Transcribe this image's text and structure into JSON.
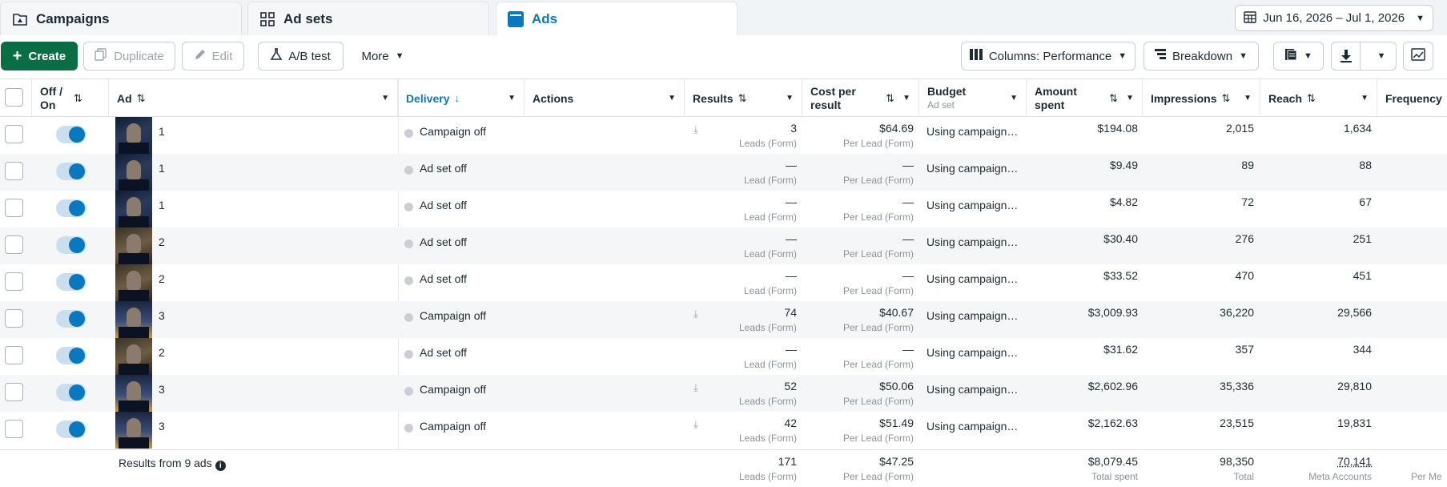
{
  "tabs": {
    "campaigns": "Campaigns",
    "adsets": "Ad sets",
    "ads": "Ads"
  },
  "date_range": "Jun 16, 2026 – Jul 1, 2026",
  "toolbar": {
    "create": "Create",
    "duplicate": "Duplicate",
    "edit": "Edit",
    "ab_test": "A/B test",
    "more": "More",
    "columns": "Columns: Performance",
    "breakdown": "Breakdown"
  },
  "headers": {
    "off_on": "Off / On",
    "ad": "Ad",
    "delivery": "Delivery",
    "actions": "Actions",
    "results": "Results",
    "cost_per_result": "Cost per result",
    "budget": "Budget",
    "budget_sub": "Ad set",
    "amount_spent": "Amount spent",
    "impressions": "Impressions",
    "reach": "Reach",
    "frequency": "Frequency"
  },
  "rows": [
    {
      "ad": "1",
      "delivery": "Campaign off",
      "results": "3",
      "results_sub": "Leads (Form)",
      "cpr": "$64.69",
      "cpr_sub": "Per Lead (Form)",
      "budget": "Using campaign…",
      "spent": "$194.08",
      "impressions": "2,015",
      "reach": "1,634",
      "thumb": "g1",
      "download": true
    },
    {
      "ad": "1",
      "delivery": "Ad set off",
      "results": "—",
      "results_sub": "Lead (Form)",
      "cpr": "—",
      "cpr_sub": "Per Lead (Form)",
      "budget": "Using campaign…",
      "spent": "$9.49",
      "impressions": "89",
      "reach": "88",
      "thumb": "g1",
      "download": false
    },
    {
      "ad": "1",
      "delivery": "Ad set off",
      "results": "—",
      "results_sub": "Lead (Form)",
      "cpr": "—",
      "cpr_sub": "Per Lead (Form)",
      "budget": "Using campaign…",
      "spent": "$4.82",
      "impressions": "72",
      "reach": "67",
      "thumb": "g1",
      "download": false
    },
    {
      "ad": "2",
      "delivery": "Ad set off",
      "results": "—",
      "results_sub": "Lead (Form)",
      "cpr": "—",
      "cpr_sub": "Per Lead (Form)",
      "budget": "Using campaign…",
      "spent": "$30.40",
      "impressions": "276",
      "reach": "251",
      "thumb": "g2",
      "download": false
    },
    {
      "ad": "2",
      "delivery": "Ad set off",
      "results": "—",
      "results_sub": "Lead (Form)",
      "cpr": "—",
      "cpr_sub": "Per Lead (Form)",
      "budget": "Using campaign…",
      "spent": "$33.52",
      "impressions": "470",
      "reach": "451",
      "thumb": "g2",
      "download": false
    },
    {
      "ad": "3",
      "delivery": "Campaign off",
      "results": "74",
      "results_sub": "Leads (Form)",
      "cpr": "$40.67",
      "cpr_sub": "Per Lead (Form)",
      "budget": "Using campaign…",
      "spent": "$3,009.93",
      "impressions": "36,220",
      "reach": "29,566",
      "thumb": "g3",
      "download": true
    },
    {
      "ad": "2",
      "delivery": "Ad set off",
      "results": "—",
      "results_sub": "Lead (Form)",
      "cpr": "—",
      "cpr_sub": "Per Lead (Form)",
      "budget": "Using campaign…",
      "spent": "$31.62",
      "impressions": "357",
      "reach": "344",
      "thumb": "g2",
      "download": false
    },
    {
      "ad": "3",
      "delivery": "Campaign off",
      "results": "52",
      "results_sub": "Leads (Form)",
      "cpr": "$50.06",
      "cpr_sub": "Per Lead (Form)",
      "budget": "Using campaign…",
      "spent": "$2,602.96",
      "impressions": "35,336",
      "reach": "29,810",
      "thumb": "g3",
      "download": true
    },
    {
      "ad": "3",
      "delivery": "Campaign off",
      "results": "42",
      "results_sub": "Leads (Form)",
      "cpr": "$51.49",
      "cpr_sub": "Per Lead (Form)",
      "budget": "Using campaign…",
      "spent": "$2,162.63",
      "impressions": "23,515",
      "reach": "19,831",
      "thumb": "g3",
      "download": true
    }
  ],
  "footer": {
    "label": "Results from 9 ads",
    "results": "171",
    "results_sub": "Leads (Form)",
    "cpr": "$47.25",
    "cpr_sub": "Per Lead (Form)",
    "spent": "$8,079.45",
    "spent_sub": "Total spent",
    "impressions": "98,350",
    "impressions_sub": "Total",
    "reach": "70,141",
    "reach_sub": "Meta Accounts",
    "frequency_sub": "Per Me"
  },
  "colors": {
    "accent": "#0a78be",
    "create_button": "#0a6e45",
    "toggle_on": "#0a78be"
  }
}
